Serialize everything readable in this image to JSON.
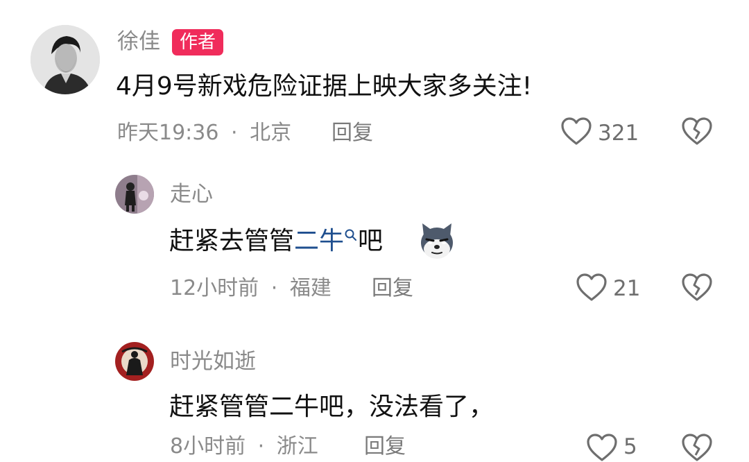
{
  "comments": [
    {
      "author": "徐佳",
      "badge": "作者",
      "text": "4月9号新戏危险证据上映大家多关注!",
      "time": "昨天19:36",
      "separator": "·",
      "location": "北京",
      "reply_label": "回复",
      "likes": "321"
    },
    {
      "author": "走心",
      "text_before": "赶紧去管管",
      "text_link": "二牛",
      "text_after": "吧",
      "time": "12小时前",
      "separator": "·",
      "location": "福建",
      "reply_label": "回复",
      "likes": "21"
    },
    {
      "author": "时光如逝",
      "text": "赶紧管管二牛吧，没法看了，",
      "time": "8小时前",
      "separator": "·",
      "location": "浙江",
      "reply_label": "回复",
      "likes": "5"
    }
  ],
  "icons": {
    "like": "heart-outline-icon",
    "dislike": "broken-heart-icon",
    "search_hint": "search-icon",
    "emoji": "dog-emoji-icon"
  },
  "colors": {
    "badge": "#f02c5b",
    "link": "#1f4f8f",
    "muted": "#8a8a8a"
  }
}
